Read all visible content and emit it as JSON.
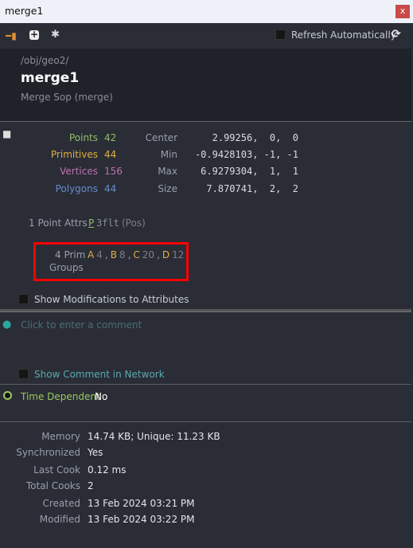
{
  "window": {
    "title": "merge1",
    "close_label": "x"
  },
  "toolbar": {
    "refresh_label": "Refresh Automatically"
  },
  "header": {
    "path": "/obj/geo2/",
    "name": "merge1",
    "type": "Merge Sop (merge)"
  },
  "stats": {
    "counts": [
      {
        "label": "Points",
        "value": "42",
        "color": "#8fbf6a"
      },
      {
        "label": "Primitives",
        "value": "44",
        "color": "#e0b040"
      },
      {
        "label": "Vertices",
        "value": "156",
        "color": "#c070b0"
      },
      {
        "label": "Polygons",
        "value": "44",
        "color": "#6a8ad0"
      }
    ],
    "bounds": [
      {
        "label": "Center",
        "value": "2.99256,  0,  0"
      },
      {
        "label": "Min",
        "value": "-0.9428103, -1, -1"
      },
      {
        "label": "Max",
        "value": "6.9279304,  1,  1"
      },
      {
        "label": "Size",
        "value": "7.870741,  2,  2"
      }
    ]
  },
  "attrs": {
    "label": "1 Point Attrs",
    "name": "P",
    "type": "3flt",
    "desc": "(Pos)"
  },
  "groups": {
    "label1": "4 Prim",
    "label2": "Groups",
    "items": [
      {
        "name": "A",
        "count": "4"
      },
      {
        "name": "B",
        "count": "8"
      },
      {
        "name": "C",
        "count": "20"
      },
      {
        "name": "D",
        "count": "12"
      }
    ]
  },
  "show_mods_label": "Show Modifications to Attributes",
  "comment": {
    "placeholder": "Click to enter a comment",
    "show_in_network": "Show Comment in Network"
  },
  "time_dependent": {
    "label": "Time Dependent",
    "value": "No"
  },
  "info": [
    {
      "label": "Memory",
      "value": "14.74 KB; Unique: 11.23 KB"
    },
    {
      "label": "Synchronized",
      "value": "Yes"
    },
    {
      "label": "Last Cook",
      "value": "0.12 ms"
    },
    {
      "label": "Total Cooks",
      "value": "2"
    },
    {
      "label": "Created",
      "value": "13 Feb 2024 03:21 PM"
    },
    {
      "label": "Modified",
      "value": "13 Feb 2024 03:22 PM"
    }
  ]
}
